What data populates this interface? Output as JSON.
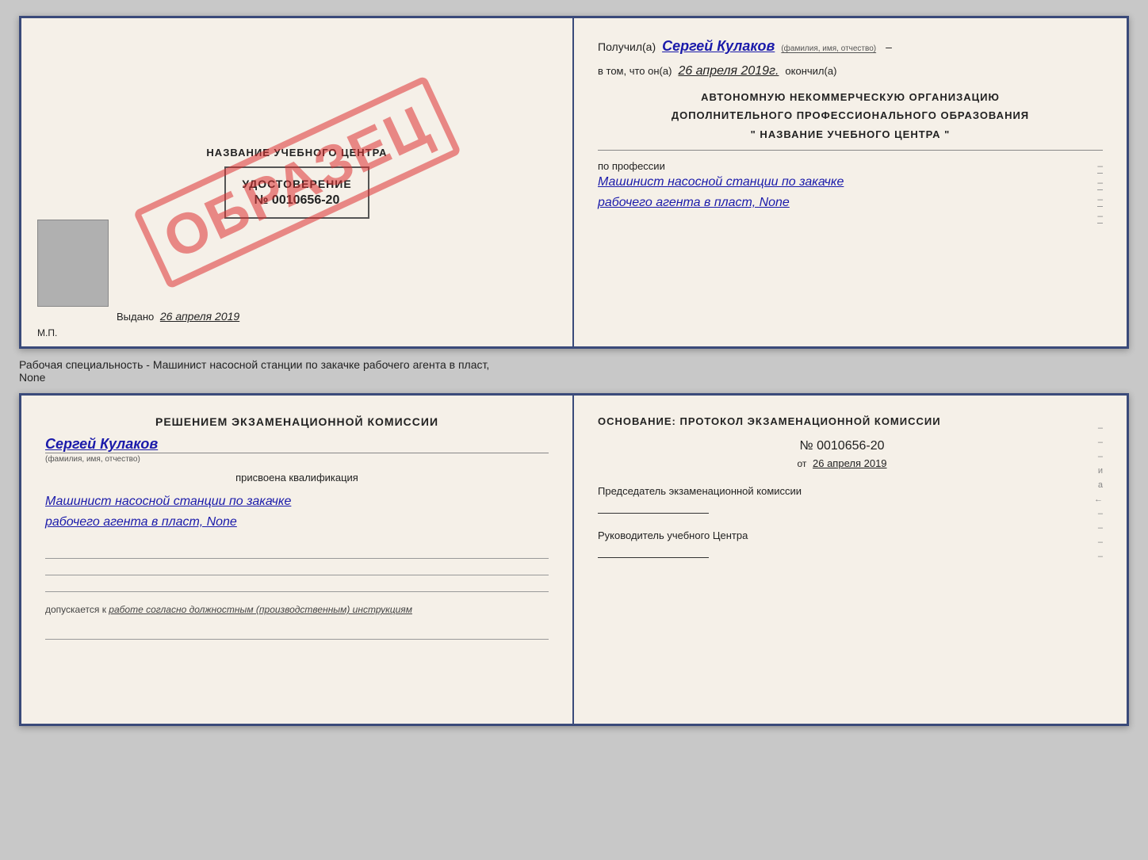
{
  "top_cert": {
    "left": {
      "title": "НАЗВАНИЕ УЧЕБНОГО ЦЕНТРА",
      "stamp": "ОБРАЗЕЦ",
      "udostoverenie_label": "УДОСТОВЕРЕНИЕ",
      "udostoverenie_number": "№ 0010656-20",
      "vydano_label": "Выдано",
      "vydano_date": "26 апреля 2019",
      "mp_label": "М.П."
    },
    "right": {
      "poluchil_label": "Получил(а)",
      "poluchil_name": "Сергей Кулаков",
      "poluchil_sub": "(фамилия, имя, отчество)",
      "vtom_label": "в том, что он(а)",
      "vtom_date": "26 апреля 2019г.",
      "okonchil_label": "окончил(а)",
      "org_line1": "АВТОНОМНУЮ НЕКОММЕРЧЕСКУЮ ОРГАНИЗАЦИЮ",
      "org_line2": "ДОПОЛНИТЕЛЬНОГО ПРОФЕССИОНАЛЬНОГО ОБРАЗОВАНИЯ",
      "org_line3": "\" НАЗВАНИЕ УЧЕБНОГО ЦЕНТРА \"",
      "po_professii_label": "по профессии",
      "profession_line1": "Машинист насосной станции по закачке",
      "profession_line2": "рабочего агента в пласт, None",
      "dash1": "–",
      "dash2": "–",
      "dash3": "–"
    }
  },
  "subtitle": "Рабочая специальность - Машинист насосной станции по закачке рабочего агента в пласт,\nNone",
  "bottom_cert": {
    "left": {
      "resheniem_text": "Решением экзаменационной комиссии",
      "fio_name": "Сергей Кулаков",
      "fio_sub": "(фамилия, имя, отчество)",
      "prisvoena_label": "присвоена квалификация",
      "qualification_line1": "Машинист насосной станции по закачке",
      "qualification_line2": "рабочего агента в пласт, None",
      "dopuskaetsya_text": "допускается к",
      "dopusk_italic": "работе согласно должностным (производственным) инструкциям"
    },
    "right": {
      "osnovanie_text": "Основание: протокол экзаменационной комиссии",
      "protocol_number": "№ 0010656-20",
      "ot_label": "от",
      "ot_date": "26 апреля 2019",
      "predsedatel_label": "Председатель экзаменационной комиссии",
      "rukovoditel_label": "Руководитель учебного Центра",
      "margin_chars": [
        "–",
        "–",
        "–",
        "и",
        "а",
        "←",
        "–",
        "–",
        "–",
        "–"
      ]
    }
  }
}
